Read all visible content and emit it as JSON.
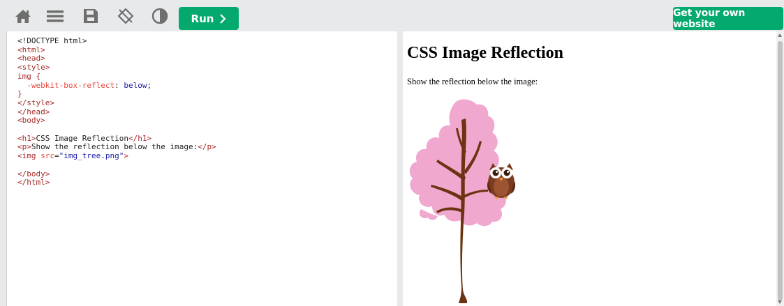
{
  "toolbar": {
    "run_label": "Run",
    "own_website_label": "Get your own website",
    "icons": [
      "home-icon",
      "menu-icon",
      "save-icon",
      "rotate-icon",
      "contrast-icon"
    ]
  },
  "code": {
    "lines": [
      "<!DOCTYPE html>",
      "<html>",
      "<head>",
      "<style>",
      "img {",
      "  -webkit-box-reflect: below;",
      "}",
      "</style>",
      "</head>",
      "<body>",
      "",
      "<h1>CSS Image Reflection</h1>",
      "<p>Show the reflection below the image:</p>",
      "<img src=\"img_tree.png\">",
      "",
      "</body>",
      "</html>"
    ],
    "doctype": "<!DOCTYPE html>",
    "property": "-webkit-box-reflect",
    "property_value": "below",
    "selector": "img {",
    "h1_text": "CSS Image Reflection",
    "p_text": "Show the reflection below the image:",
    "img_src": "\"img_tree.png\""
  },
  "result": {
    "title": "CSS Image Reflection",
    "text": "Show the reflection below the image:"
  },
  "colors": {
    "brand_green": "#04aa6d",
    "toolbar_bg": "#e7e9eb",
    "tag": "#a52a2a",
    "attr": "#e8483c",
    "value": "#1a1aa6"
  }
}
